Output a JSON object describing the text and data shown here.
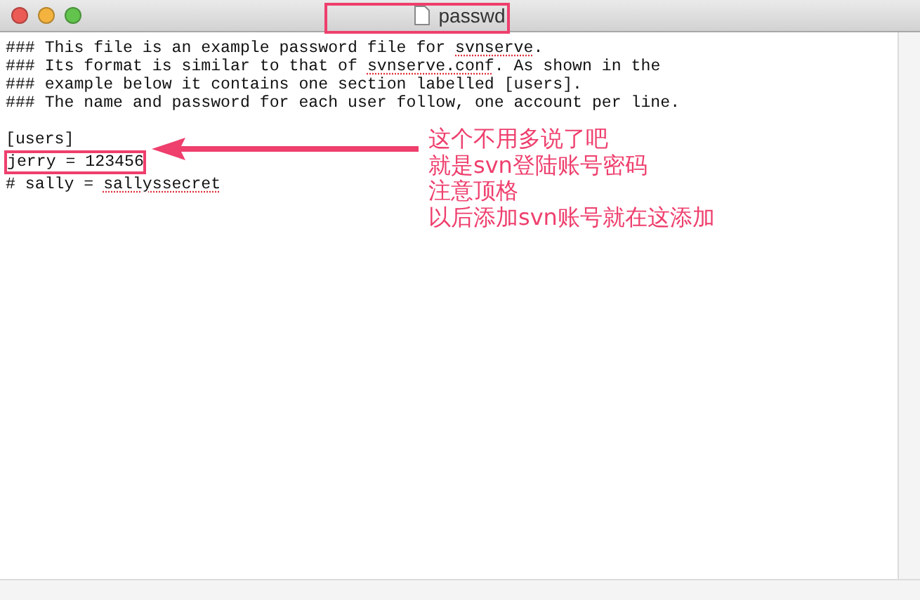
{
  "window": {
    "title": "passwd"
  },
  "document": {
    "lines": [
      {
        "segments": [
          {
            "text": "### This file is an example password file for ",
            "misspelled": false
          },
          {
            "text": "svnserve",
            "misspelled": true
          },
          {
            "text": ".",
            "misspelled": false
          }
        ]
      },
      {
        "segments": [
          {
            "text": "### Its format is similar to that of ",
            "misspelled": false
          },
          {
            "text": "svnserve.conf",
            "misspelled": true
          },
          {
            "text": ". As shown in the",
            "misspelled": false
          }
        ]
      },
      {
        "segments": [
          {
            "text": "### example below it contains one section labelled [users].",
            "misspelled": false
          }
        ]
      },
      {
        "segments": [
          {
            "text": "### The name and password for each user follow, one account per line.",
            "misspelled": false
          }
        ]
      },
      {
        "segments": [
          {
            "text": "[users]",
            "misspelled": false
          }
        ],
        "blank_line_before": true
      },
      {
        "segments": [
          {
            "text": "jerry = 123456",
            "misspelled": false
          }
        ],
        "highlighted": true
      },
      {
        "segments": [
          {
            "text": "# sally = ",
            "misspelled": false
          },
          {
            "text": "sallyssecret",
            "misspelled": true
          }
        ]
      }
    ]
  },
  "annotation": {
    "lines": [
      "这个不用多说了吧",
      "就是svn登陆账号密码",
      "注意顶格",
      "以后添加svn账号就在这添加"
    ]
  }
}
